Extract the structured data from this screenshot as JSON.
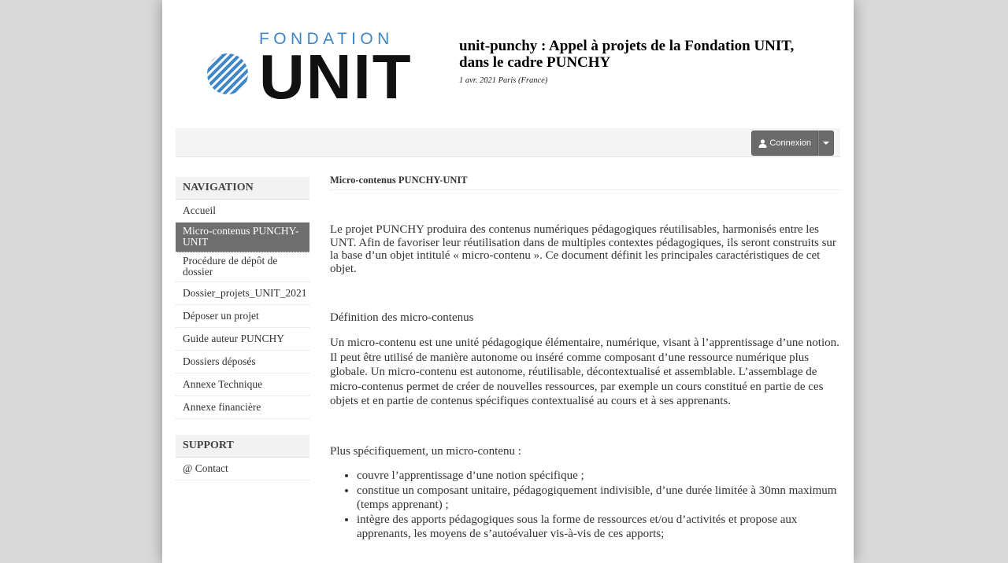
{
  "header": {
    "logo_top_text": "FONDATION",
    "logo_word": "UNIT",
    "title": "unit-punchy : Appel à projets de la Fondation UNIT, dans le cadre PUNCHY",
    "date": "1 avr. 2021 Paris (France)"
  },
  "toolbar": {
    "login_label": "Connexion"
  },
  "sidebar": {
    "nav_header": "NAVIGATION",
    "items": [
      {
        "label": "Accueil"
      },
      {
        "label": "Micro-contenus PUNCHY-UNIT"
      },
      {
        "label": "Procédure de dépôt de dossier"
      },
      {
        "label": "Dossier_projets_UNIT_2021"
      },
      {
        "label": "Déposer un projet"
      },
      {
        "label": "Guide auteur PUNCHY"
      },
      {
        "label": "Dossiers déposés"
      },
      {
        "label": "Annexe Technique"
      },
      {
        "label": "Annexe financière"
      }
    ],
    "support_header": "SUPPORT",
    "support_items": [
      {
        "label": "@ Contact"
      }
    ]
  },
  "main": {
    "title": "Micro-contenus PUNCHY-UNIT",
    "intro": "Le projet PUNCHY produira des contenus numériques pédagogiques réutilisables, harmonisés entre les UNT. Afin de favoriser leur réutilisation dans de multiples contextes pédagogiques, ils seront construits sur la base d’un objet intitulé « micro-contenu ». Ce document définit les principales caractéristiques de cet objet.",
    "definition_title": "Définition des micro-contenus",
    "definition_text": "Un micro-contenu est une unité pédagogique élémentaire, numérique, visant à l’apprentissage d’une notion. Il peut être utilisé de manière autonome ou inséré comme composant d’une ressource numérique plus globale. Un micro-contenu est autonome, réutilisable, décontextualisé et assemblable. L’assemblage de micro-contenus permet de créer de nouvelles ressources, par exemple un cours constitué en partie de ces objets et en partie de contenus spécifiques contextualisé au cours et à ses apprenants.",
    "specific_intro": "Plus spécifiquement, un micro-contenu :",
    "bullets": [
      "couvre l’apprentissage d’une notion spécifique ;",
      "constitue un composant unitaire, pédagogiquement indivisible, d’une durée limitée à 30mn maximum (temps apprenant) ;",
      "intègre des apports pédagogiques sous la forme de ressources et/ou d’activités et propose aux apprenants, les moyens de s’autoévaluer vis-à-vis de ces apports;"
    ]
  },
  "colors": {
    "background": "#d9d9d9",
    "logo_blue": "#3f86c6",
    "active_nav": "#6e6e6e",
    "button": "#6b6b6b"
  }
}
